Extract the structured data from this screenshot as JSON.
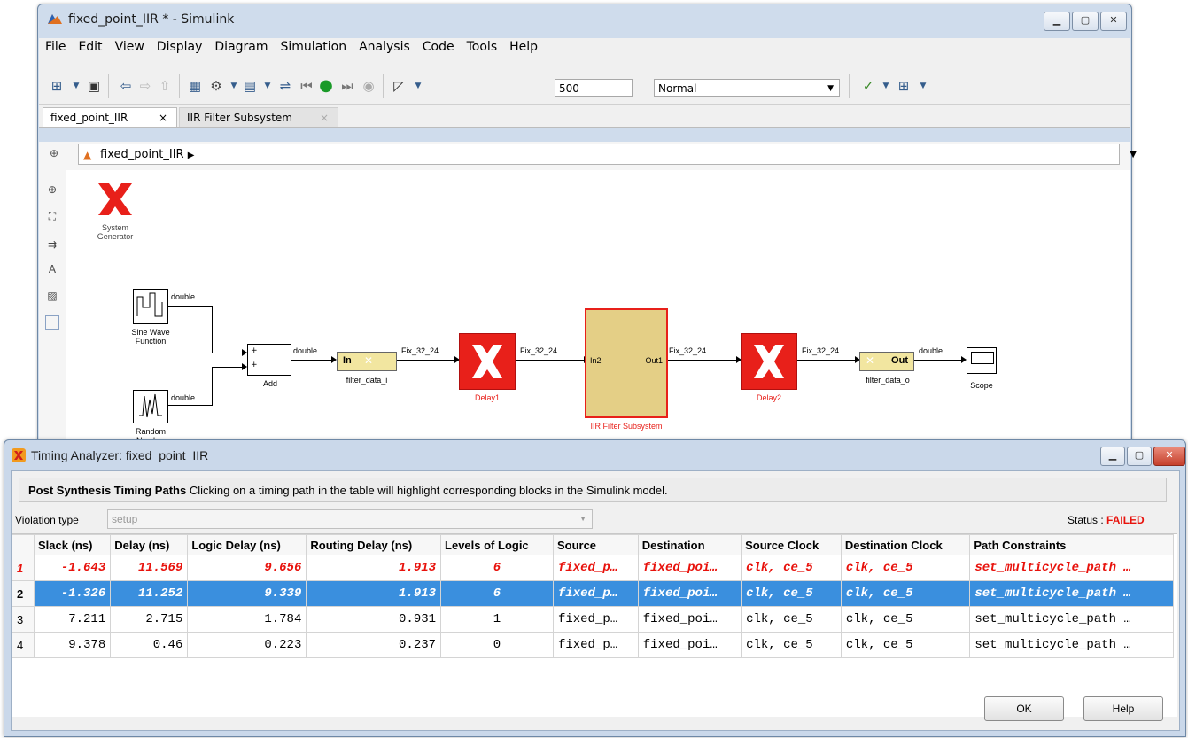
{
  "simulink": {
    "title": "fixed_point_IIR * - Simulink",
    "menu": [
      "File",
      "Edit",
      "View",
      "Display",
      "Diagram",
      "Simulation",
      "Analysis",
      "Code",
      "Tools",
      "Help"
    ],
    "stop_time": "500",
    "sim_mode": "Normal",
    "tabs": [
      {
        "label": "fixed_point_IIR",
        "close": "×"
      },
      {
        "label": "IIR Filter Subsystem",
        "close": "×"
      }
    ],
    "breadcrumb": "fixed_point_IIR",
    "blocks": {
      "sysgen": "System\nGenerator",
      "sine": "Sine Wave\nFunction",
      "random": "Random\nNumber",
      "add": "Add",
      "filter_in": "filter_data_i",
      "filter_in_port": "In",
      "delay1": "Delay1",
      "subsystem": "IIR Filter Subsystem",
      "sub_in": "In2",
      "sub_out": "Out1",
      "delay2": "Delay2",
      "filter_out": "filter_data_o",
      "filter_out_port": "Out",
      "scope": "Scope"
    },
    "signals": {
      "sine_out": "double",
      "random_out": "double",
      "add_out": "double",
      "in_out": "Fix_32_24",
      "delay1_out": "Fix_32_24",
      "sub_out": "Fix_32_24",
      "delay2_out": "Fix_32_24",
      "out_out": "double"
    },
    "colors": {
      "xilinx_red": "#e8201a",
      "subsystem_fill": "#e4cf86",
      "gateway_fill": "#f2e6a0"
    }
  },
  "timing": {
    "title": "Timing Analyzer: fixed_point_IIR",
    "header_bold": "Post Synthesis Timing Paths",
    "header_text": "Clicking on a timing path in the table will highlight corresponding blocks in the Simulink model.",
    "violation_label": "Violation type",
    "violation_value": "setup",
    "status_label": "Status :",
    "status_value": "FAILED",
    "columns": [
      "Slack (ns)",
      "Delay (ns)",
      "Logic Delay (ns)",
      "Routing Delay (ns)",
      "Levels of Logic",
      "Source",
      "Destination",
      "Source Clock",
      "Destination Clock",
      "Path Constraints"
    ],
    "rows": [
      {
        "n": "1",
        "slack": "-1.643",
        "delay": "11.569",
        "logic": "9.656",
        "routing": "1.913",
        "levels": "6",
        "source": "fixed_p…",
        "dest": "fixed_poi…",
        "sclk": "clk, ce_5",
        "dclk": "clk, ce_5",
        "constraint": "set_multicycle_path …",
        "state": "fail"
      },
      {
        "n": "2",
        "slack": "-1.326",
        "delay": "11.252",
        "logic": "9.339",
        "routing": "1.913",
        "levels": "6",
        "source": "fixed_p…",
        "dest": "fixed_poi…",
        "sclk": "clk, ce_5",
        "dclk": "clk, ce_5",
        "constraint": "set_multicycle_path …",
        "state": "selected"
      },
      {
        "n": "3",
        "slack": "7.211",
        "delay": "2.715",
        "logic": "1.784",
        "routing": "0.931",
        "levels": "1",
        "source": "fixed_p…",
        "dest": "fixed_poi…",
        "sclk": "clk, ce_5",
        "dclk": "clk, ce_5",
        "constraint": "set_multicycle_path …",
        "state": "ok"
      },
      {
        "n": "4",
        "slack": "9.378",
        "delay": "0.46",
        "logic": "0.223",
        "routing": "0.237",
        "levels": "0",
        "source": "fixed_p…",
        "dest": "fixed_poi…",
        "sclk": "clk, ce_5",
        "dclk": "clk, ce_5",
        "constraint": "set_multicycle_path …",
        "state": "ok"
      }
    ],
    "ok_label": "OK",
    "help_label": "Help"
  }
}
